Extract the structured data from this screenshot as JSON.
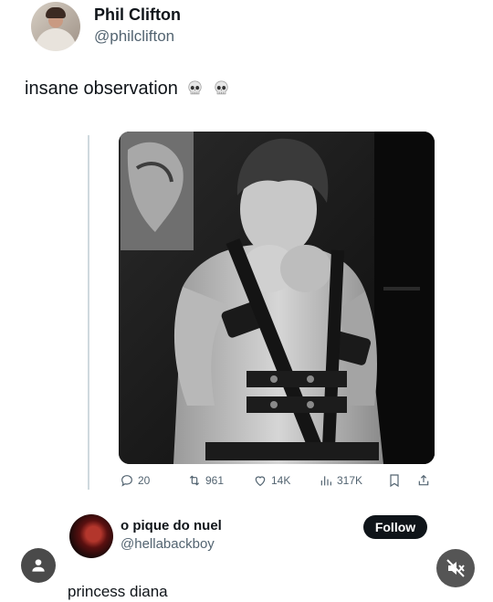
{
  "tweet": {
    "author_name": "Phil Clifton",
    "author_handle": "@philclifton",
    "text": "insane observation",
    "emoji": [
      "skull-icon",
      "skull-icon"
    ]
  },
  "quoted_post": {
    "stats": {
      "replies": "20",
      "reposts": "961",
      "likes": "14K",
      "views": "317K"
    }
  },
  "reply": {
    "author_name": "o pique do nuel",
    "author_handle": "@hellabackboy",
    "follow_label": "Follow",
    "text": "princess diana"
  },
  "colors": {
    "text": "#0f1419",
    "secondary": "#536471",
    "follow_bg": "#0f1419",
    "thread_line": "#cfd9de"
  }
}
